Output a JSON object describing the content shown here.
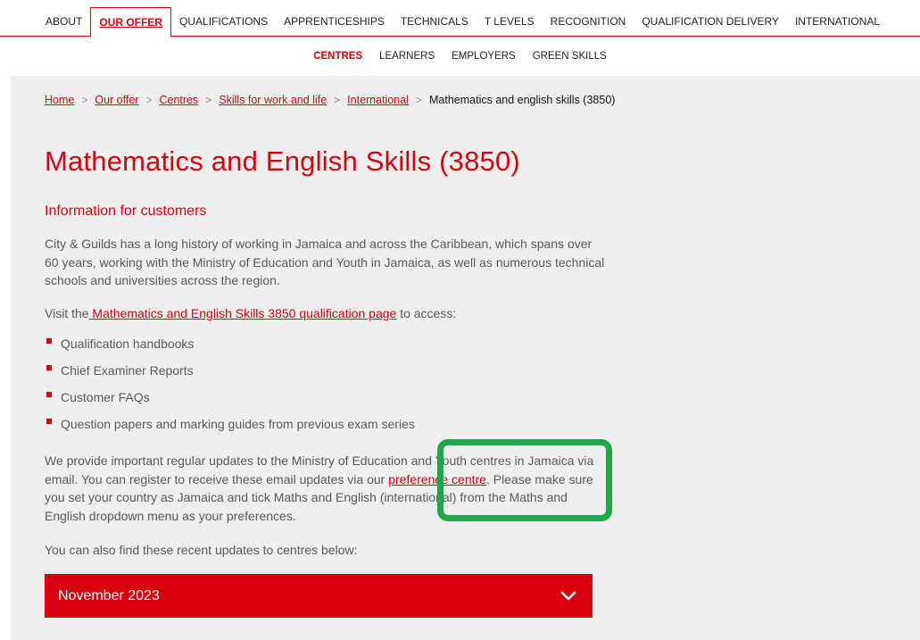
{
  "top_nav": {
    "items": [
      "ABOUT",
      "OUR OFFER",
      "QUALIFICATIONS",
      "APPRENTICESHIPS",
      "TECHNICALS",
      "T LEVELS",
      "RECOGNITION",
      "QUALIFICATION DELIVERY",
      "INTERNATIONAL"
    ],
    "active": "OUR OFFER"
  },
  "sub_nav": {
    "items": [
      "CENTRES",
      "LEARNERS",
      "EMPLOYERS",
      "GREEN SKILLS"
    ],
    "active": "CENTRES"
  },
  "breadcrumb": {
    "links": [
      "Home",
      "Our offer",
      "Centres",
      "Skills for work and life",
      "International"
    ],
    "current": "Mathematics and english skills (3850)"
  },
  "page": {
    "title": "Mathematics and English Skills (3850)",
    "section_heading": "Information for customers",
    "intro": "City & Guilds has a long history of working in Jamaica and across the Caribbean, which spans over 60 years, working with the Ministry of Education and Youth in Jamaica, as well as numerous technical schools and universities across the region.",
    "visit_prefix": "Visit the",
    "visit_link": " Mathematics and English Skills 3850 qualification page",
    "visit_suffix": " to access:",
    "bullets": [
      "Qualification handbooks",
      "Chief Examiner Reports",
      "Customer FAQs",
      "Question papers and marking guides from previous exam series"
    ],
    "updates_text_1": "We provide important regular updates to the Ministry of Education and Youth centres in Jamaica via email. You can register to receive these email updates via our ",
    "updates_link": "preference centre",
    "updates_text_2": ". Please make sure you set your country as Jamaica and tick Maths and English (international) from the Maths and English dropdown menu as your preferences.",
    "recent_updates_text": "You can also find these recent updates to centres below:"
  },
  "accordion": {
    "title": "November 2023",
    "expanded": false
  },
  "colors": {
    "brand_red": "#d8000c",
    "highlight_green": "#1fa84a",
    "content_bg": "#efefef"
  }
}
